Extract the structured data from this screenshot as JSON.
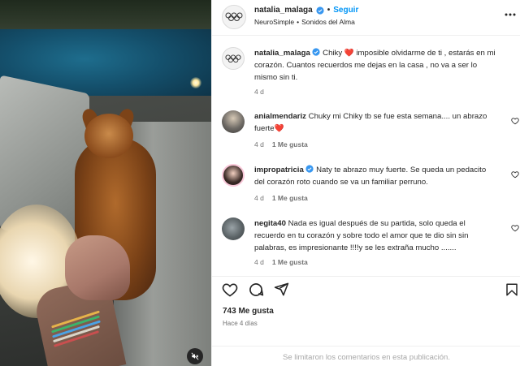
{
  "post": {
    "author": "natalia_malaga",
    "follow_label": "Seguir",
    "separator": "•",
    "audio_artist": "NeuroSimple",
    "audio_song": "Sonidos del Alma",
    "more_icon": "more-dots-icon"
  },
  "caption": {
    "author": "natalia_malaga",
    "text_before_heart": "Chiky ",
    "heart": "❤️",
    "text_after_heart": " imposible olvidarme de ti , estarás en mi corazón. Cuantos recuerdos me dejas en la casa , no va a ser lo mismo sin ti.",
    "age": "4 d"
  },
  "comments": [
    {
      "author": "anialmendariz",
      "text": "Chuky mi Chiky tb se fue esta semana.... un abrazo fuerte",
      "trailing_emoji": "❤️",
      "age": "4 d",
      "likes": "1 Me gusta"
    },
    {
      "author": "impropatricia",
      "verified": true,
      "text": "Naty te abrazo muy fuerte. Se queda un pedacito del corazón roto cuando se va un familiar perruno.",
      "age": "4 d",
      "likes": "1 Me gusta"
    },
    {
      "author": "negita40",
      "text": "Nada es igual después de su partida, solo queda el recuerdo en tu corazón y sobre todo el amor que te dio sin sin palabras, es impresionante !!!!y se les extraña mucho .......",
      "age": "4 d",
      "likes": "1 Me gusta"
    }
  ],
  "footer": {
    "likes_count": "743 Me gusta",
    "posted_ago": "Hace 4 días",
    "comments_limited": "Se limitaron los comentarios en esta publicación."
  },
  "colors": {
    "link_blue": "#0095f6",
    "verified_blue": "#3897f0",
    "heart_red": "#e0245e",
    "muted_gray": "#737373"
  }
}
